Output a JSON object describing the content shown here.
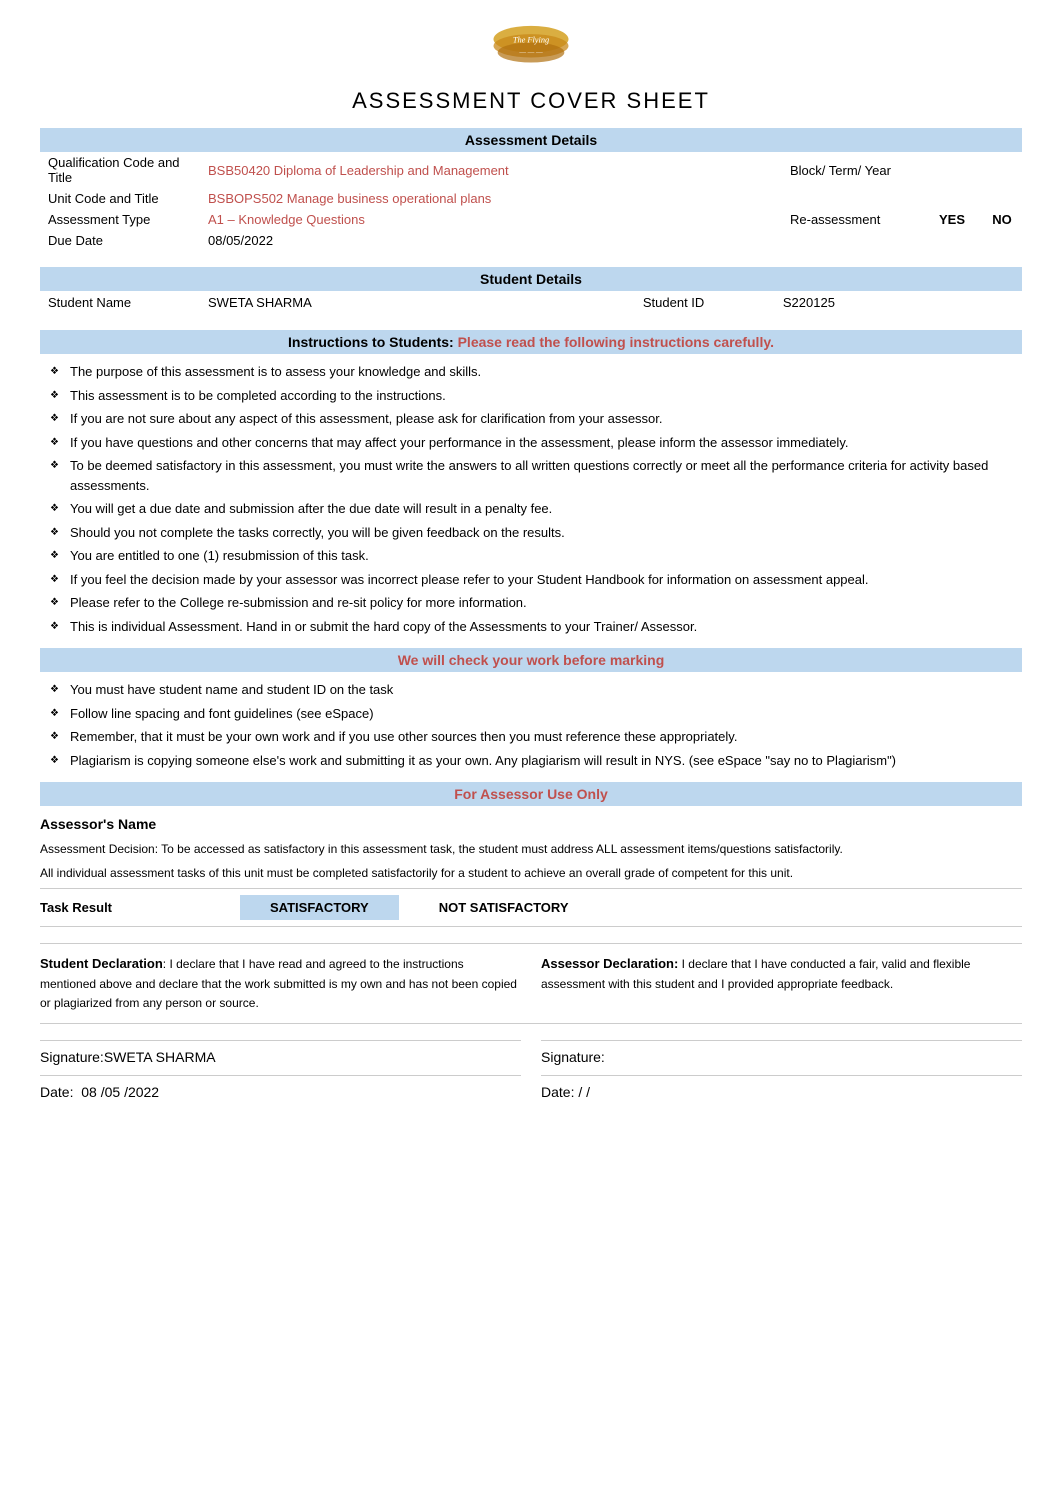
{
  "logo": {
    "alt": "Institution Logo"
  },
  "title": "ASSESSMENT COVER SHEET",
  "assessment_details": {
    "header": "Assessment Details",
    "qualification_label": "Qualification Code and Title",
    "qualification_value": "BSB50420 Diploma of Leadership and Management",
    "block_term_year": "Block/ Term/ Year",
    "unit_label": "Unit Code and Title",
    "unit_value": "BSBOPS502 Manage business operational plans",
    "assessment_type_label": "Assessment Type",
    "assessment_type_value": "A1 – Knowledge Questions",
    "reassessment_label": "Re-assessment",
    "yes_label": "YES",
    "no_label": "NO",
    "due_date_label": "Due Date",
    "due_date_value": "08/05/2022"
  },
  "student_details": {
    "header": "Student Details",
    "name_label": "Student Name",
    "name_value": "SWETA SHARMA",
    "id_label": "Student ID",
    "id_value": "S220125"
  },
  "instructions": {
    "header_prefix": "Instructions to Students:",
    "header_suffix": "  Please read the following instructions carefully.",
    "items": [
      "The purpose of this assessment is to assess your knowledge and skills.",
      "This assessment is to be completed according to the instructions.",
      "If you are not sure about any aspect of this assessment, please ask for clarification from your assessor.",
      "If you have questions and other concerns that may affect your performance in the assessment, please inform the assessor immediately.",
      "To be deemed satisfactory in this assessment, you must write the answers to all written questions correctly or meet all the performance criteria for activity based assessments.",
      "You will get a due date and submission after the due date will result in a penalty fee.",
      "Should you not complete the tasks correctly, you will be given feedback on the results.",
      "You are entitled to one (1) resubmission of this task.",
      "If you feel the decision made by your assessor was incorrect please refer to your Student Handbook for information on assessment appeal.",
      "Please refer to the College re-submission and re-sit policy for more information.",
      "This is individual Assessment. Hand in or submit the hard copy of the Assessments to your Trainer/ Assessor."
    ],
    "we_will_check": "We will check your work before marking",
    "check_items": [
      "You must have student name and student ID on the task",
      "Follow line spacing and font guidelines (see eSpace)",
      "Remember, that it must be your own work and if you use other sources then you must reference these appropriately.",
      "Plagiarism is copying someone else's work and submitting it as your own. Any plagiarism will result in NYS. (see eSpace \"say no to Plagiarism\")"
    ]
  },
  "assessor_section": {
    "header": "For Assessor Use Only",
    "name_label": "Assessor's Name",
    "decision_text1": "Assessment Decision: To be accessed as satisfactory in this assessment task, the student must address ALL assessment items/questions satisfactorily.",
    "decision_text2": "All individual assessment tasks of this unit must be completed satisfactorily for a student to achieve an overall grade of competent for this unit.",
    "task_result_label": "Task Result",
    "satisfactory": "SATISFACTORY",
    "not_satisfactory": "NOT SATISFACTORY"
  },
  "declarations": {
    "student_title": "Student Declaration",
    "student_text": ": I declare that I have read and agreed to the instructions mentioned above and declare that the work submitted is my own and has not been copied or plagiarized from any person or source.",
    "assessor_title": "Assessor Declaration:",
    "assessor_text": "I declare that I have conducted a fair, valid and flexible assessment with this student and I provided appropriate feedback."
  },
  "signatures": {
    "student_sig_label": "Signature:SWETA SHARMA",
    "assessor_sig_label": "Signature:",
    "student_date_label": "Date:",
    "student_date_value": "08 /05 /2022",
    "assessor_date_label": "Date:",
    "assessor_date_slashes": "  /  /"
  }
}
